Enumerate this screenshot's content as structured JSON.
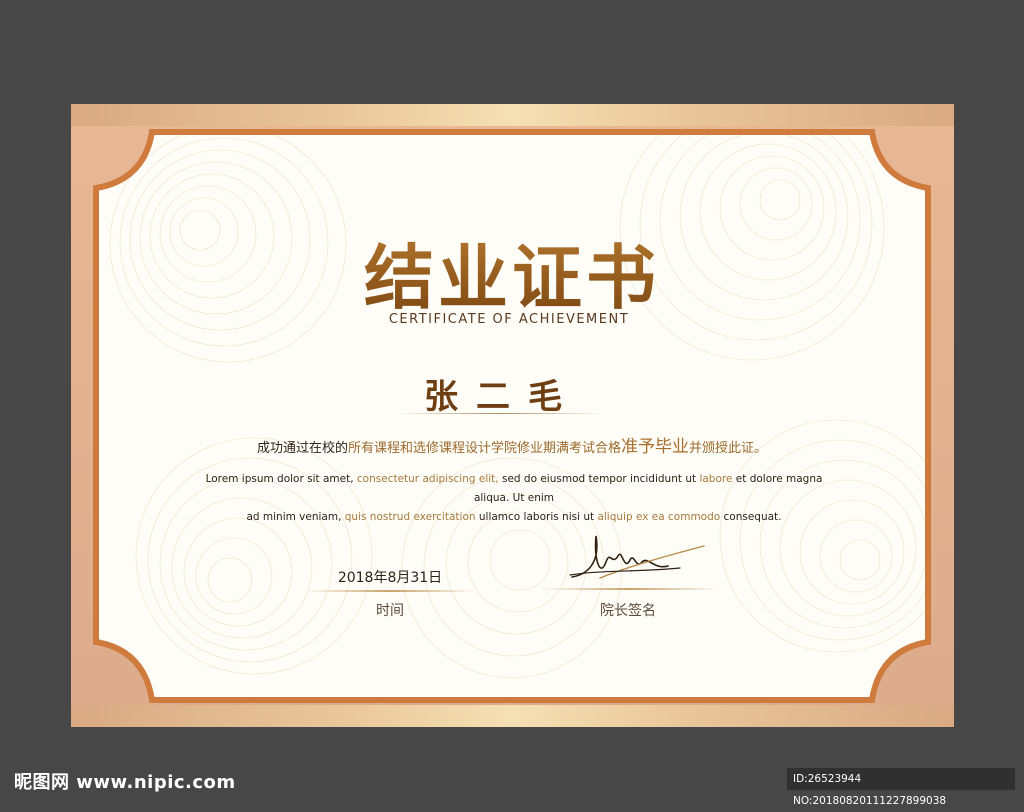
{
  "certificate": {
    "title": "结业证书",
    "subtitle": "CERTIFICATE OF ACHIEVEMENT",
    "recipient_name": "张二毛",
    "statement": {
      "part1": "成功通过在校的",
      "part2": "所有课程和选修课程设计学院修业期满考试合格",
      "part3": "准予毕业",
      "part4": "并颁授此证。"
    },
    "lorem": {
      "line1_a": "Lorem ipsum dolor sit amet, ",
      "line1_b": "consectetur adipiscing elit,",
      "line1_c": " sed do eiusmod tempor incididunt ut ",
      "line1_d": "labore",
      "line1_e": " et dolore magna aliqua. Ut enim",
      "line2_a": "ad minim veniam, ",
      "line2_b": "quis nostrud exercitation",
      "line2_c": " ullamco laboris nisi ut ",
      "line2_d": "aliquip ex ea commodo",
      "line2_e": " consequat."
    },
    "date": "2018年8月31日",
    "date_label": "时间",
    "signature_label": "院长签名"
  },
  "watermark": {
    "site": "昵图网 www.nipic.com",
    "id_text": "ID:26523944 NO:20180820111227899038"
  },
  "colors": {
    "background": "#474747",
    "outer_border": "#dcab8c",
    "frame_stroke": "#cf7b3e",
    "title_gold": "#8a5016"
  }
}
